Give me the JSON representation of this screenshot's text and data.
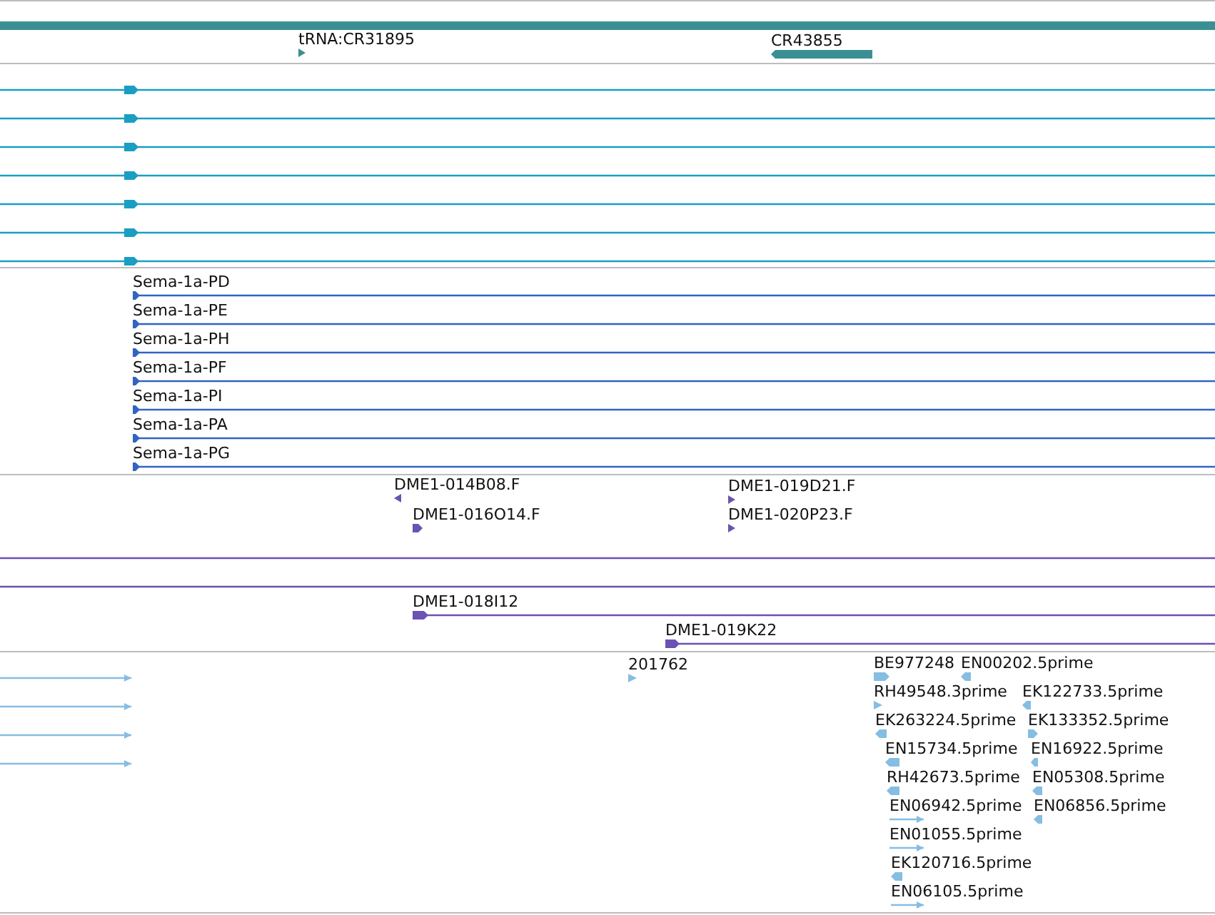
{
  "tracks": [
    {
      "color": "#3a8f94",
      "features": [
        {
          "kind": "bar"
        },
        {
          "kind": "arrow",
          "reverse": false,
          "label": "tRNA:CR31895"
        },
        {
          "kind": "block",
          "reverse": true,
          "label": "CR43855"
        }
      ]
    },
    {
      "color": "#1a9ec2",
      "features": [
        {
          "kind": "transcript",
          "reverse": false
        },
        {
          "kind": "transcript",
          "reverse": false
        },
        {
          "kind": "transcript",
          "reverse": false
        },
        {
          "kind": "transcript",
          "reverse": false
        },
        {
          "kind": "transcript",
          "reverse": false
        },
        {
          "kind": "transcript",
          "reverse": false
        },
        {
          "kind": "transcript",
          "reverse": false
        }
      ]
    },
    {
      "color": "#3164c4",
      "features": [
        {
          "kind": "transcript",
          "reverse": false,
          "label": "Sema-1a-PD"
        },
        {
          "kind": "transcript",
          "reverse": false,
          "label": "Sema-1a-PE"
        },
        {
          "kind": "transcript",
          "reverse": false,
          "label": "Sema-1a-PH"
        },
        {
          "kind": "transcript",
          "reverse": false,
          "label": "Sema-1a-PF"
        },
        {
          "kind": "transcript",
          "reverse": false,
          "label": "Sema-1a-PI"
        },
        {
          "kind": "transcript",
          "reverse": false,
          "label": "Sema-1a-PA"
        },
        {
          "kind": "transcript",
          "reverse": false,
          "label": "Sema-1a-PG"
        }
      ]
    },
    {
      "color": "#6b52b3",
      "features": [
        {
          "kind": "arrow",
          "reverse": true,
          "label": "DME1-014B08.F"
        },
        {
          "kind": "block",
          "reverse": false,
          "label": "DME1-016O14.F"
        },
        {
          "kind": "arrow",
          "reverse": false,
          "label": "DME1-019D21.F"
        },
        {
          "kind": "arrow",
          "reverse": false,
          "label": "DME1-020P23.F"
        },
        {
          "kind": "line"
        },
        {
          "kind": "line"
        },
        {
          "kind": "transcript",
          "reverse": false,
          "label": "DME1-018I12"
        },
        {
          "kind": "transcript",
          "reverse": false,
          "label": "DME1-019K22"
        }
      ]
    },
    {
      "color": "#86bde2",
      "features": [
        {
          "kind": "line",
          "reverse": false
        },
        {
          "kind": "line",
          "reverse": false
        },
        {
          "kind": "line",
          "reverse": false
        },
        {
          "kind": "line",
          "reverse": false
        },
        {
          "kind": "arrow",
          "reverse": false,
          "label": "201762"
        },
        {
          "kind": "block",
          "reverse": false,
          "label": "BE977248"
        },
        {
          "kind": "arrow",
          "reverse": false,
          "label": "RH49548.3prime"
        },
        {
          "kind": "block",
          "reverse": true,
          "label": "EK263224.5prime"
        },
        {
          "kind": "block",
          "reverse": true,
          "label": "EN15734.5prime"
        },
        {
          "kind": "block",
          "reverse": true,
          "label": "RH42673.5prime"
        },
        {
          "kind": "line",
          "reverse": false,
          "label": "EN06942.5prime"
        },
        {
          "kind": "line",
          "reverse": false,
          "label": "EN01055.5prime"
        },
        {
          "kind": "block",
          "reverse": true,
          "label": "EK120716.5prime"
        },
        {
          "kind": "line",
          "reverse": false,
          "label": "EN06105.5prime"
        },
        {
          "kind": "block",
          "reverse": true,
          "label": "EN00202.5prime"
        },
        {
          "kind": "block",
          "reverse": true,
          "label": "EK122733.5prime"
        },
        {
          "kind": "block",
          "reverse": false,
          "label": "EK133352.5prime"
        },
        {
          "kind": "block",
          "reverse": true,
          "label": "EN16922.5prime"
        },
        {
          "kind": "block",
          "reverse": true,
          "label": "EN05308.5prime"
        },
        {
          "kind": "block",
          "reverse": true,
          "label": "EN06856.5prime"
        }
      ]
    }
  ]
}
